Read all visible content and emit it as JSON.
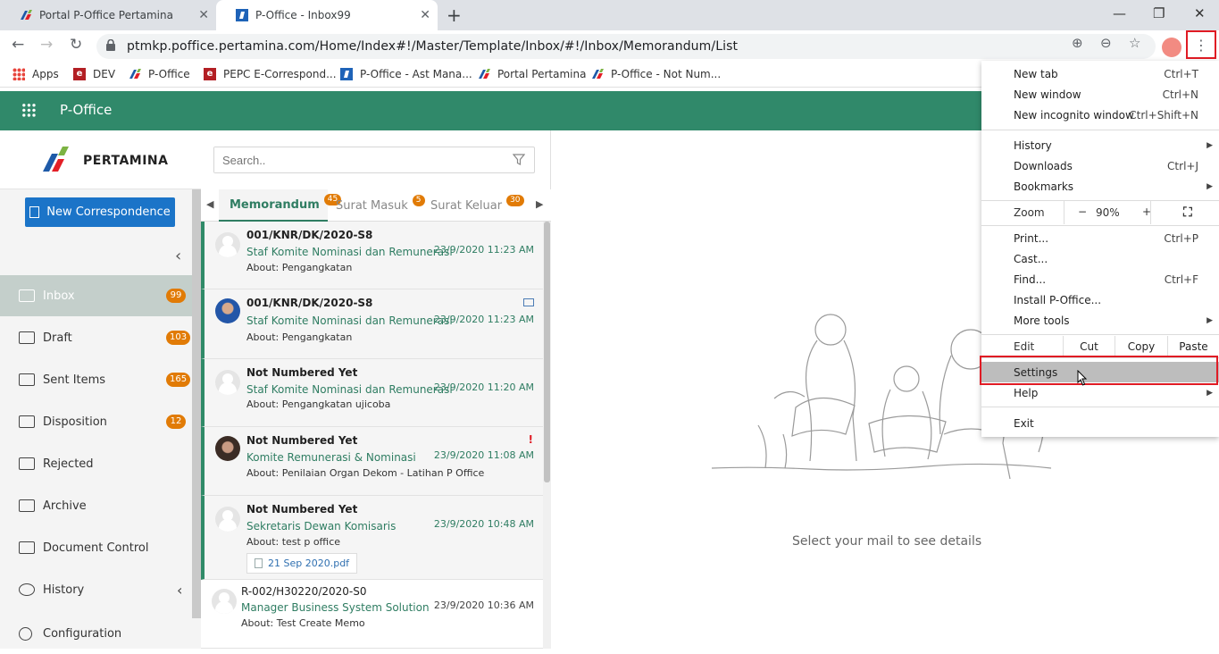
{
  "browser": {
    "tabs": [
      {
        "title": "Portal P-Office Pertamina"
      },
      {
        "title": "P-Office - Inbox99"
      }
    ],
    "url": "ptmkp.poffice.pertamina.com/Home/Index#!/Master/Template/Inbox/#!/Inbox/Memorandum/List",
    "bookmarks": [
      {
        "label": "Apps",
        "icon": "apps-grid-icon"
      },
      {
        "label": "DEV",
        "icon": "e-red-icon"
      },
      {
        "label": "P-Office",
        "icon": "pertamina-icon"
      },
      {
        "label": "PEPC E-Correspond...",
        "icon": "e-red-icon"
      },
      {
        "label": "P-Office - Ast Mana...",
        "icon": "p-blue-icon"
      },
      {
        "label": "Portal Pertamina",
        "icon": "pertamina-icon"
      },
      {
        "label": "P-Office - Not Num...",
        "icon": "pertamina-icon"
      }
    ]
  },
  "app": {
    "title": "P-Office",
    "logo_text": "PERTAMINA",
    "accent": "#30896a"
  },
  "sidebar": {
    "new_button": "New Correspondence",
    "items": [
      {
        "label": "Inbox",
        "badge": "99",
        "icon": "inbox-icon"
      },
      {
        "label": "Draft",
        "badge": "103",
        "icon": "draft-icon"
      },
      {
        "label": "Sent Items",
        "badge": "165",
        "icon": "sent-icon"
      },
      {
        "label": "Disposition",
        "badge": "12",
        "icon": "disposition-icon"
      },
      {
        "label": "Rejected",
        "badge": "",
        "icon": "rejected-icon"
      },
      {
        "label": "Archive",
        "badge": "",
        "icon": "archive-icon"
      },
      {
        "label": "Document Control",
        "badge": "",
        "icon": "document-control-icon"
      },
      {
        "label": "History",
        "badge": "",
        "icon": "history-icon"
      },
      {
        "label": "Configuration",
        "badge": "",
        "icon": "gear-icon"
      }
    ]
  },
  "list": {
    "search_placeholder": "Search..",
    "tabs": [
      {
        "label": "Memorandum",
        "badge": "45"
      },
      {
        "label": "Surat Masuk",
        "badge": "5"
      },
      {
        "label": "Surat Keluar",
        "badge": "30"
      }
    ],
    "messages": [
      {
        "number": "001/KNR/DK/2020-S8",
        "from": "Staf Komite Nominasi dan Remunerasi",
        "about": "About: Pengangkatan",
        "date": "23/9/2020 11:23 AM"
      },
      {
        "number": "001/KNR/DK/2020-S8",
        "from": "Staf Komite Nominasi dan Remunerasi",
        "about": "About: Pengangkatan",
        "date": "23/9/2020 11:23 AM"
      },
      {
        "number": "Not Numbered Yet",
        "from": "Staf Komite Nominasi dan Remunerasi",
        "about": "About: Pengangkatan ujicoba",
        "date": "23/9/2020 11:20 AM"
      },
      {
        "number": "Not Numbered Yet",
        "from": "Komite Remunerasi & Nominasi",
        "about": "About: Penilaian Organ Dekom - Latihan P Office",
        "date": "23/9/2020 11:08 AM",
        "flag": "!"
      },
      {
        "number": "Not Numbered Yet",
        "from": "Sekretaris Dewan Komisaris",
        "about": "About: test p office",
        "date": "23/9/2020 10:48 AM",
        "attachment": "21 Sep 2020.pdf"
      },
      {
        "number": "R-002/H30220/2020-S0",
        "from": "Manager Business System Solution",
        "about": "About: Test Create Memo",
        "date": "23/9/2020 10:36 AM"
      }
    ]
  },
  "detail": {
    "empty_text": "Select your mail to see details"
  },
  "chrome_menu": {
    "new_tab": {
      "label": "New tab",
      "shortcut": "Ctrl+T"
    },
    "new_window": {
      "label": "New window",
      "shortcut": "Ctrl+N"
    },
    "incognito": {
      "label": "New incognito window",
      "shortcut": "Ctrl+Shift+N"
    },
    "history": {
      "label": "History"
    },
    "downloads": {
      "label": "Downloads",
      "shortcut": "Ctrl+J"
    },
    "bookmarks": {
      "label": "Bookmarks"
    },
    "zoom": {
      "label": "Zoom",
      "minus": "−",
      "value": "90%",
      "plus": "+"
    },
    "print": {
      "label": "Print...",
      "shortcut": "Ctrl+P"
    },
    "cast": {
      "label": "Cast..."
    },
    "find": {
      "label": "Find...",
      "shortcut": "Ctrl+F"
    },
    "install": {
      "label": "Install P-Office..."
    },
    "more_tools": {
      "label": "More tools"
    },
    "edit": {
      "label": "Edit",
      "cut": "Cut",
      "copy": "Copy",
      "paste": "Paste"
    },
    "settings": {
      "label": "Settings"
    },
    "help": {
      "label": "Help"
    },
    "exit": {
      "label": "Exit"
    }
  }
}
